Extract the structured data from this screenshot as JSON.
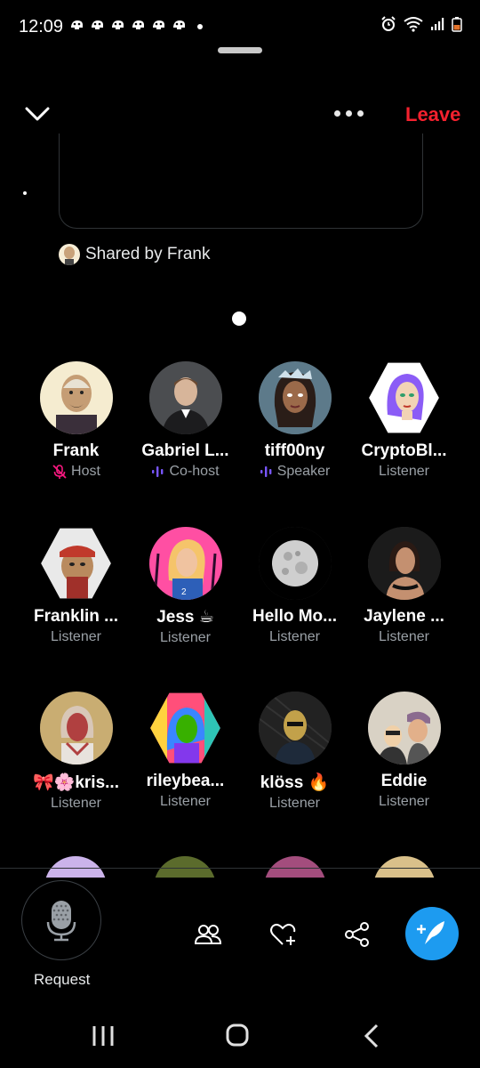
{
  "status_bar": {
    "time": "12:09"
  },
  "header": {
    "leave_label": "Leave"
  },
  "shared": {
    "text": "Shared by Frank"
  },
  "participants": [
    {
      "name": "Frank",
      "role": "Host",
      "role_icon": "mic-off-icon",
      "role_color": "#f91880"
    },
    {
      "name": "Gabriel L...",
      "role": "Co-host",
      "role_icon": "speaking-bars-icon",
      "role_color": "#7856ff"
    },
    {
      "name": "tiff00ny",
      "role": "Speaker",
      "role_icon": "speaking-bars-icon",
      "role_color": "#7856ff"
    },
    {
      "name": "CryptoBl...",
      "role": "Listener"
    },
    {
      "name": "Franklin ...",
      "role": "Listener"
    },
    {
      "name": "Jess ☕",
      "role": "Listener"
    },
    {
      "name": "Hello Mo...",
      "role": "Listener"
    },
    {
      "name": "Jaylene ...",
      "role": "Listener"
    },
    {
      "name": "🎀🌸kris...",
      "role": "Listener"
    },
    {
      "name": "rileybea...",
      "role": "Listener"
    },
    {
      "name": "klöss 🔥",
      "role": "Listener"
    },
    {
      "name": "Eddie",
      "role": "Listener"
    }
  ],
  "bottom_bar": {
    "request_label": "Request"
  },
  "colors": {
    "accent": "#1d9bf0",
    "leave": "#f4212e",
    "host_accent": "#f91880",
    "speaker_accent": "#7856ff"
  }
}
